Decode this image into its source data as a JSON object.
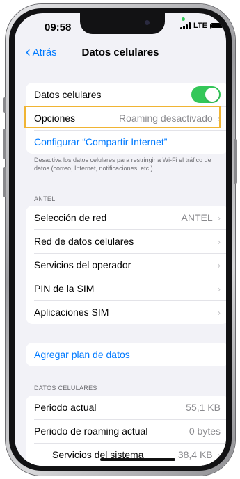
{
  "status_bar": {
    "time": "09:58",
    "network": "LTE"
  },
  "nav": {
    "back_label": "Atrás",
    "title": "Datos celulares"
  },
  "group1": {
    "datos_celulares": {
      "label": "Datos celulares",
      "toggle_on": true
    },
    "opciones": {
      "label": "Opciones",
      "value": "Roaming desactivado"
    },
    "compartir": {
      "label": "Configurar “Compartir Internet”"
    }
  },
  "note": "Desactiva los datos celulares para restringir a Wi-Fi el tráfico de datos (correo, Internet, notificaciones, etc.).",
  "carrier_section": {
    "header": "ANTEL",
    "items": [
      {
        "label": "Selección de red",
        "value": "ANTEL"
      },
      {
        "label": "Red de datos celulares",
        "value": ""
      },
      {
        "label": "Servicios del operador",
        "value": ""
      },
      {
        "label": "PIN de la SIM",
        "value": ""
      },
      {
        "label": "Aplicaciones SIM",
        "value": ""
      }
    ]
  },
  "plan": {
    "label": "Agregar plan de datos"
  },
  "usage_section": {
    "header": "DATOS CELULARES",
    "items": [
      {
        "label": "Periodo actual",
        "value": "55,1 KB"
      },
      {
        "label": "Periodo de roaming actual",
        "value": "0 bytes"
      },
      {
        "label": "Servicios del sistema",
        "value": "38,4 KB"
      }
    ]
  },
  "colors": {
    "accent": "#007aff",
    "toggle_on": "#34c759",
    "highlight": "#f0b433"
  }
}
